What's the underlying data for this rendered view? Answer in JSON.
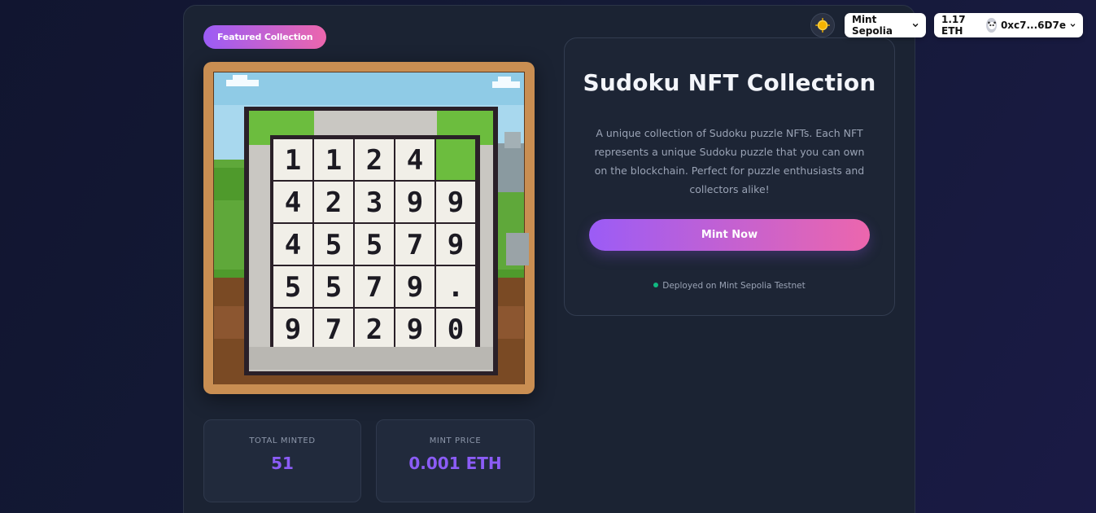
{
  "header": {
    "network_label": "Mint Sepolia",
    "balance": "1.17 ETH",
    "address": "0xc7...6D7e",
    "theme_icon": "sun-icon"
  },
  "collection": {
    "badge": "Featured Collection",
    "title": "Sudoku NFT Collection",
    "description": "A unique collection of Sudoku puzzle NFTs. Each NFT represents a unique Sudoku puzzle that you can own on the blockchain. Perfect for puzzle enthusiasts and collectors alike!",
    "mint_button": "Mint Now",
    "deployed_text": "Deployed on Mint Sepolia Testnet"
  },
  "stats": {
    "total_minted_label": "TOTAL MINTED",
    "total_minted_value": "51",
    "mint_price_label": "MINT PRICE",
    "mint_price_value": "0.001 ETH"
  },
  "artwork": {
    "grid_rows": [
      [
        "1",
        "1",
        "2",
        "4",
        ""
      ],
      [
        "4",
        "2",
        "3",
        "9",
        "9"
      ],
      [
        "4",
        "5",
        "5",
        "7",
        "9"
      ],
      [
        "5",
        "5",
        "7",
        "9",
        "."
      ],
      [
        "9",
        "7",
        "2",
        "9",
        "0"
      ]
    ]
  },
  "colors": {
    "accent_start": "#9b5cf6",
    "accent_end": "#ec66ad",
    "stat_value": "#8b5cf6",
    "status_dot": "#10b981"
  }
}
